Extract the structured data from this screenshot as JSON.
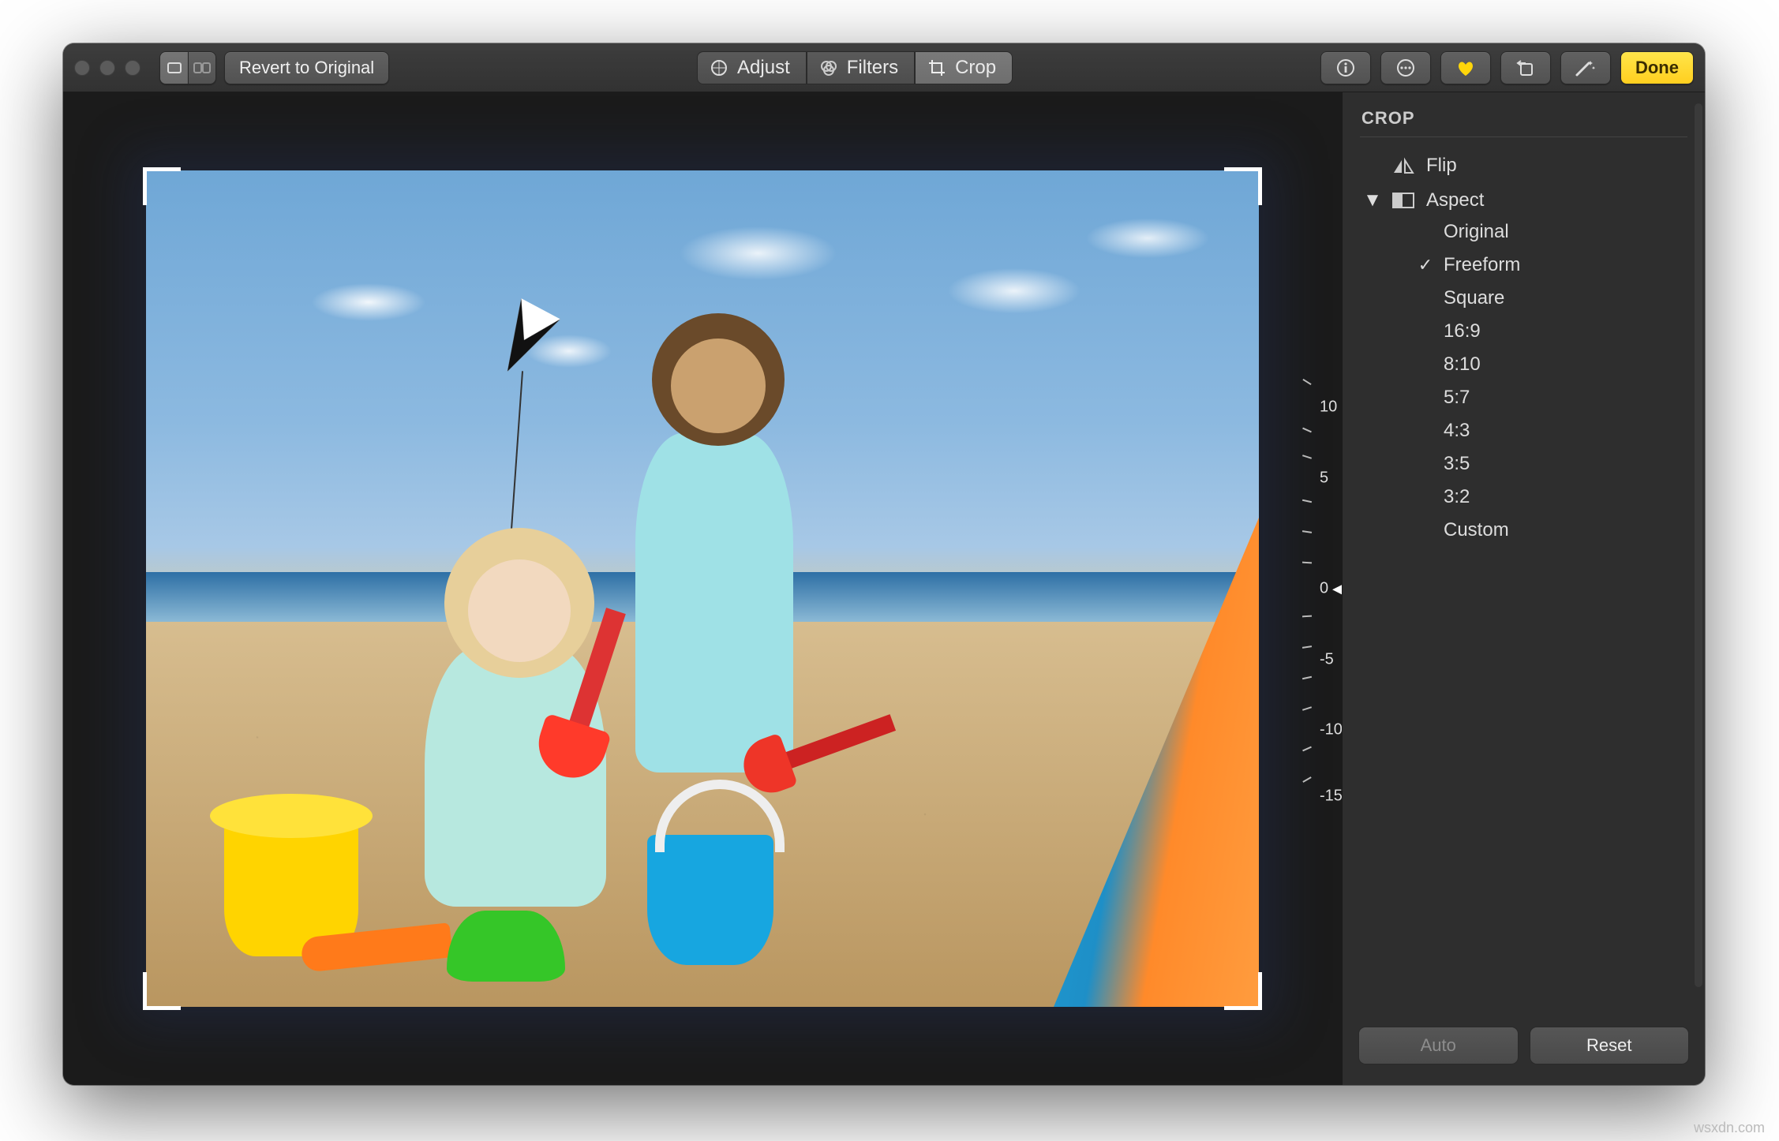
{
  "toolbar": {
    "revert_label": "Revert to Original",
    "done_label": "Done"
  },
  "tabs": {
    "adjust": "Adjust",
    "filters": "Filters",
    "crop": "Crop"
  },
  "panel": {
    "title": "CROP",
    "flip": "Flip",
    "aspect": "Aspect",
    "options": {
      "original": "Original",
      "freeform": "Freeform",
      "square": "Square",
      "r16_9": "16:9",
      "r8_10": "8:10",
      "r5_7": "5:7",
      "r4_3": "4:3",
      "r3_5": "3:5",
      "r3_2": "3:2",
      "custom": "Custom"
    }
  },
  "dial": {
    "m15": "-15",
    "m10": "-10",
    "m5": "-5",
    "zero": "0",
    "p5": "5",
    "p10": "10"
  },
  "footer": {
    "auto": "Auto",
    "reset": "Reset"
  },
  "watermark": "wsxdn.com"
}
